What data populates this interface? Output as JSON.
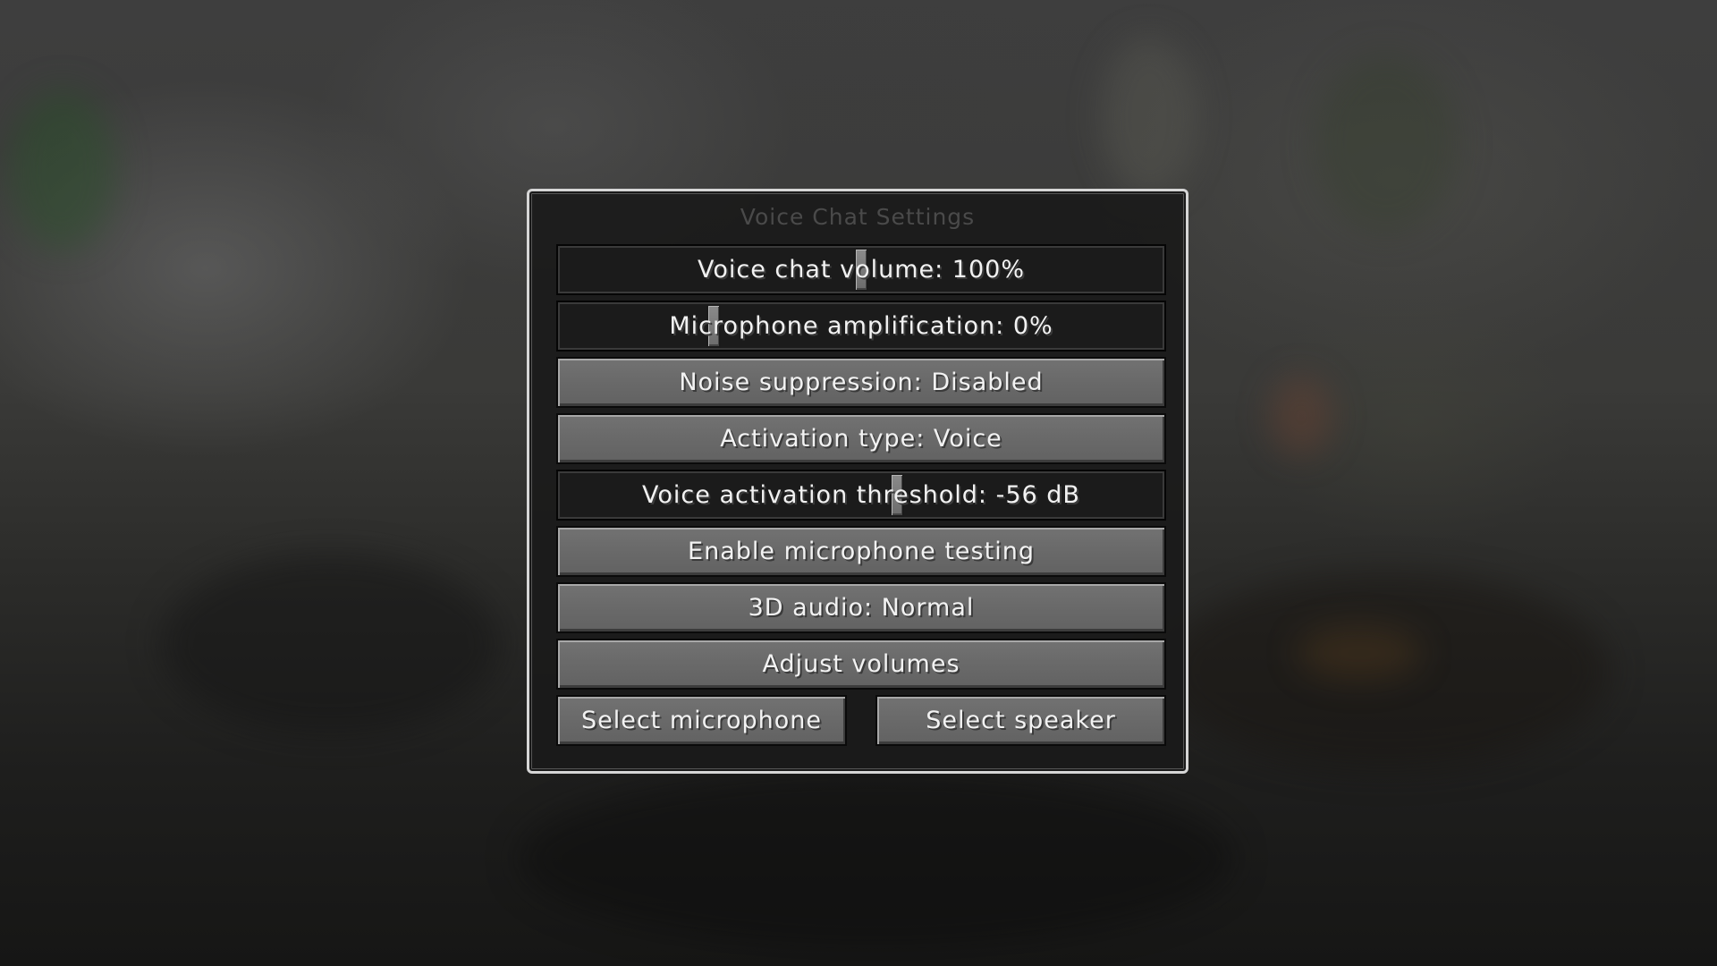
{
  "title": "Voice Chat Settings",
  "sliders": {
    "voice_chat_volume": {
      "label": "Voice chat volume: 100%",
      "value": 1.0,
      "knob_fraction": 0.5
    },
    "microphone_amplification": {
      "label": "Microphone amplification: 0%",
      "value": 0.0,
      "knob_fraction": 0.25
    },
    "voice_activation_threshold": {
      "label": "Voice activation threshold: -56 dB",
      "value_db": -56,
      "knob_fraction": 0.56
    }
  },
  "buttons": {
    "noise_suppression": "Noise suppression: Disabled",
    "activation_type": "Activation type: Voice",
    "enable_mic_testing": "Enable microphone testing",
    "audio_3d": "3D audio: Normal",
    "adjust_volumes": "Adjust volumes",
    "select_microphone": "Select microphone",
    "select_speaker": "Select speaker"
  }
}
